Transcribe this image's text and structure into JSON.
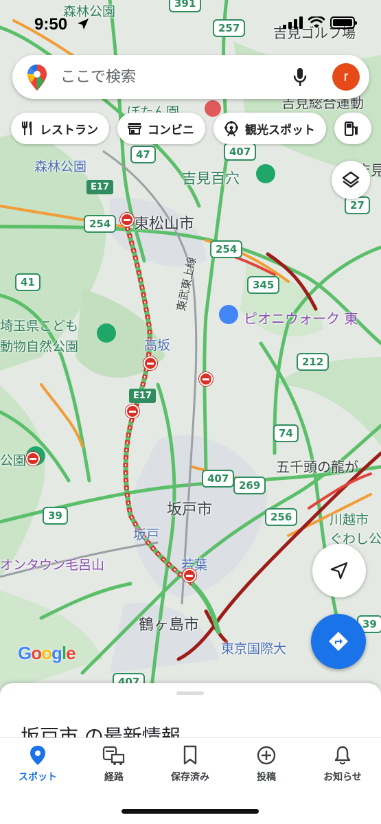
{
  "status_bar": {
    "time": "9:50"
  },
  "search": {
    "placeholder": "ここで検索",
    "avatar_letter": "r"
  },
  "chips": [
    {
      "label": "レストラン",
      "icon": "restaurant-icon"
    },
    {
      "label": "コンビニ",
      "icon": "store-icon"
    },
    {
      "label": "観光スポット",
      "icon": "attraction-icon"
    }
  ],
  "map": {
    "places": [
      {
        "text": "森林公園",
        "style": "green"
      },
      {
        "text": "吉見ゴルフ場",
        "style": "dark"
      },
      {
        "text": "ぼたん園",
        "style": "green"
      },
      {
        "text": "吉見総合運動",
        "style": "dark"
      },
      {
        "text": "森林公園",
        "style": "blue"
      },
      {
        "text": "吉見百穴",
        "style": "green"
      },
      {
        "text": "吉見",
        "style": "dark"
      },
      {
        "text": "東松山市",
        "style": "dark"
      },
      {
        "text": "東武東上線",
        "style": "dark"
      },
      {
        "text": "ピオニウォーク 東",
        "style": "purple"
      },
      {
        "text": "埼玉県こども",
        "style": "green"
      },
      {
        "text": "動物自然公園",
        "style": "green"
      },
      {
        "text": "高坂",
        "style": "blue"
      },
      {
        "text": "五千頭の龍が",
        "style": "dark"
      },
      {
        "text": "公園",
        "style": "green"
      },
      {
        "text": "坂戸市",
        "style": "dark"
      },
      {
        "text": "川越市",
        "style": "green"
      },
      {
        "text": "ぐわし公",
        "style": "green"
      },
      {
        "text": "坂戸",
        "style": "blue"
      },
      {
        "text": "オンタウン毛呂山",
        "style": "purple"
      },
      {
        "text": "若葉",
        "style": "blue"
      },
      {
        "text": "鶴ヶ島市",
        "style": "dark"
      },
      {
        "text": "東京国際大",
        "style": "blue"
      }
    ],
    "route_shields": [
      "391",
      "257",
      "47",
      "407",
      "E17",
      "254",
      "254",
      "27",
      "41",
      "345",
      "212",
      "E17",
      "74",
      "407",
      "269",
      "256",
      "39",
      "39",
      "407"
    ],
    "attribution": "Google"
  },
  "sheet": {
    "title": "坂戸市 の最新情報"
  },
  "nav": [
    {
      "label": "スポット",
      "icon": "explore-pin-icon",
      "active": true
    },
    {
      "label": "経路",
      "icon": "commute-icon",
      "active": false
    },
    {
      "label": "保存済み",
      "icon": "bookmark-icon",
      "active": false
    },
    {
      "label": "投稿",
      "icon": "add-circle-icon",
      "active": false
    },
    {
      "label": "お知らせ",
      "icon": "bell-icon",
      "active": false
    }
  ],
  "colors": {
    "accent": "#1a73e8",
    "traffic_jam": "#d93025",
    "avatar": "#e64a19"
  }
}
